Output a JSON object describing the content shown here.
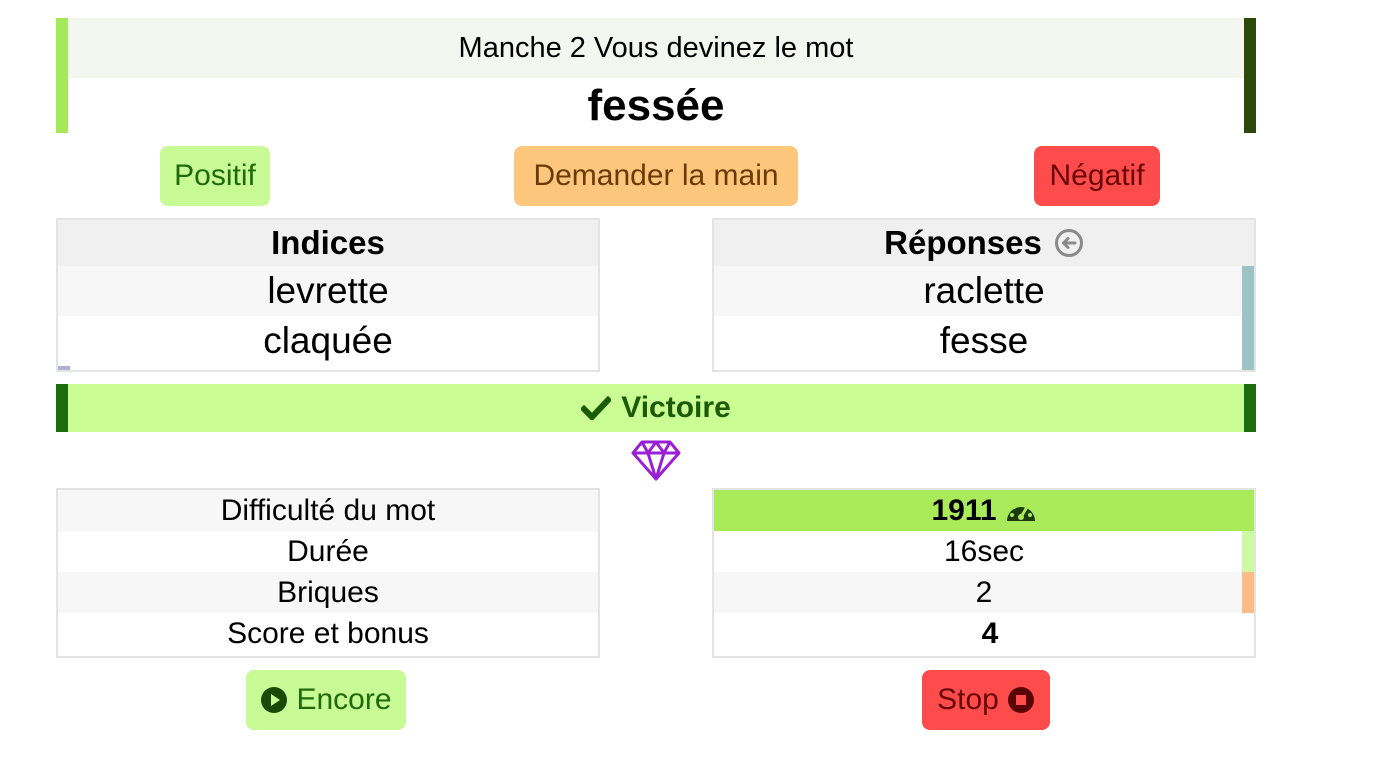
{
  "header": {
    "round_label": "Manche 2",
    "prompt": "Vous devinez le mot",
    "word": "fessée"
  },
  "actions": {
    "positive_label": "Positif",
    "ask_hand_label": "Demander la main",
    "negative_label": "Négatif"
  },
  "hints": {
    "title": "Indices",
    "items": [
      "levrette",
      "claquée"
    ]
  },
  "answers": {
    "title": "Réponses",
    "items": [
      "raclette",
      "fesse"
    ]
  },
  "result": {
    "label": "Victoire",
    "icon": "check-icon"
  },
  "stats": {
    "labels": [
      "Difficulté du mot",
      "Durée",
      "Briques",
      "Score et bonus"
    ],
    "difficulty": "1911",
    "duration": "16sec",
    "bricks": "2",
    "score": "4"
  },
  "footer": {
    "again_label": "Encore",
    "stop_label": "Stop"
  },
  "colors": {
    "positive": "#c8fb95",
    "hand": "#fdc67d",
    "negative": "#fe4c4d",
    "victory": "#cbfd95",
    "gem": "#9b1fd6"
  }
}
